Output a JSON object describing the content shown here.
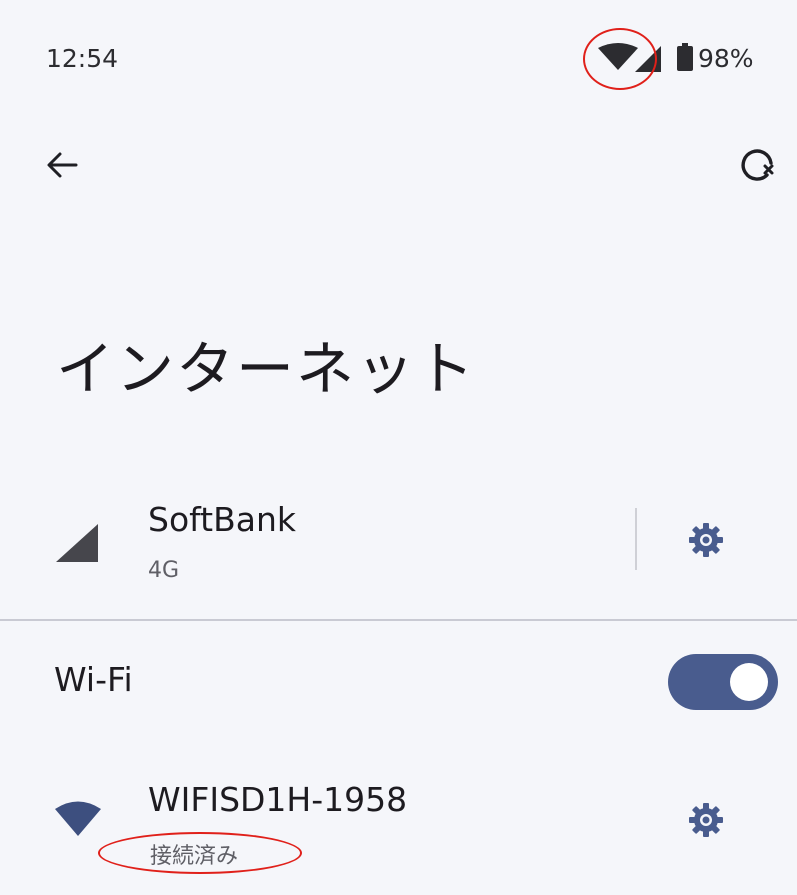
{
  "status_bar": {
    "time": "12:54",
    "battery_percent": "98%",
    "icons": [
      "wifi-icon",
      "cell-signal-icon",
      "battery-icon"
    ]
  },
  "toolbar": {
    "back_icon": "arrow-left-icon",
    "history_icon": "history-icon"
  },
  "page": {
    "title": "インターネット"
  },
  "mobile_network": {
    "name": "SoftBank",
    "type": "4G",
    "icon": "cell-signal-icon",
    "settings_icon": "gear-icon"
  },
  "wifi": {
    "label": "Wi-Fi",
    "enabled": true,
    "toggle_color": "#495c8e"
  },
  "connected_network": {
    "ssid": "WIFISD1H-1958",
    "status": "接続済み",
    "icon": "wifi-icon",
    "settings_icon": "gear-icon"
  },
  "annotation_color": "#e0201a"
}
